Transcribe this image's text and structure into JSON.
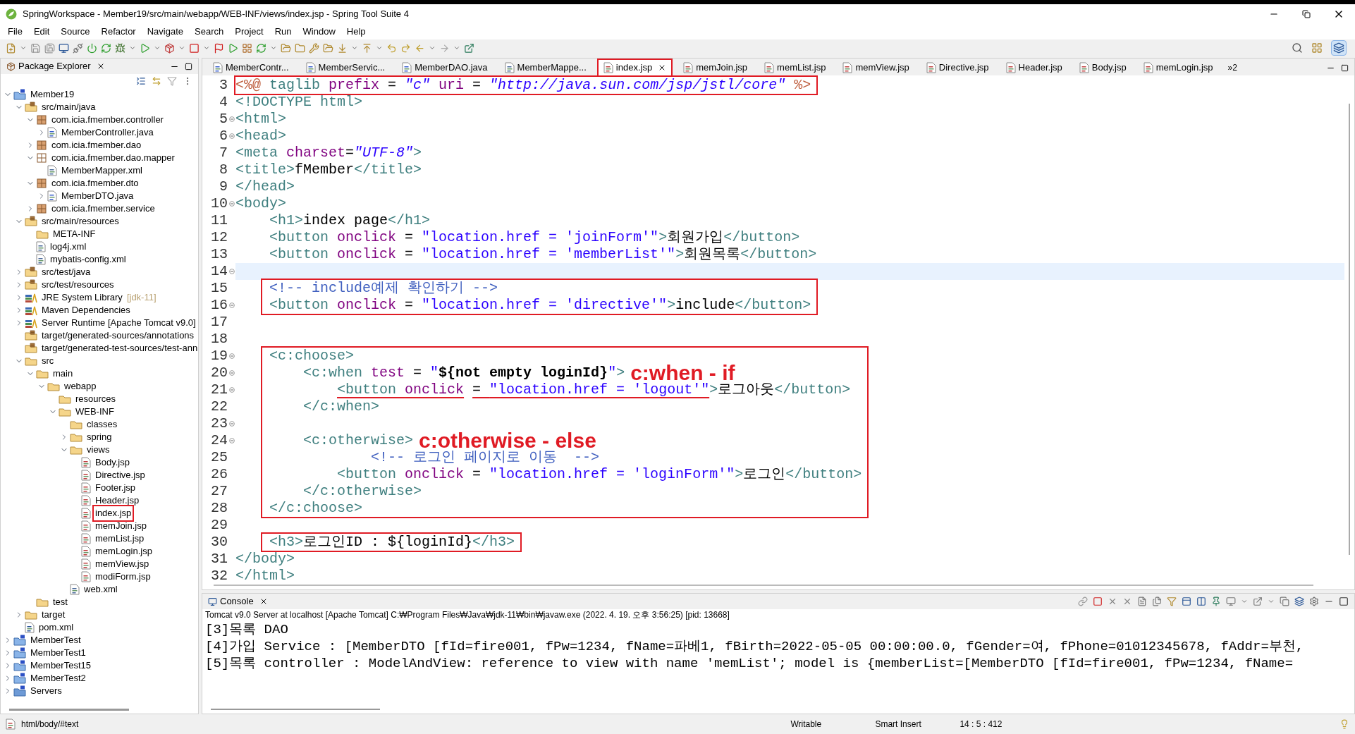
{
  "window": {
    "title": "SpringWorkspace - Member19/src/main/webapp/WEB-INF/views/index.jsp - Spring Tool Suite 4"
  },
  "menu": [
    "File",
    "Edit",
    "Source",
    "Refactor",
    "Navigate",
    "Search",
    "Project",
    "Run",
    "Window",
    "Help"
  ],
  "explorer": {
    "title": "Package Explorer",
    "tree": [
      {
        "label": "Member19",
        "kind": "project",
        "expanded": true,
        "children": [
          {
            "label": "src/main/java",
            "kind": "source-folder",
            "expanded": true,
            "children": [
              {
                "label": "com.icia.fmember.controller",
                "kind": "package",
                "expanded": true,
                "children": [
                  {
                    "label": "MemberController.java",
                    "kind": "java",
                    "expanded": false
                  }
                ]
              },
              {
                "label": "com.icia.fmember.dao",
                "kind": "package",
                "expanded": false
              },
              {
                "label": "com.icia.fmember.dao.mapper",
                "kind": "package-empty",
                "expanded": true,
                "children": [
                  {
                    "label": "MemberMapper.xml",
                    "kind": "xml"
                  }
                ]
              },
              {
                "label": "com.icia.fmember.dto",
                "kind": "package",
                "expanded": true,
                "children": [
                  {
                    "label": "MemberDTO.java",
                    "kind": "java",
                    "expanded": false
                  }
                ]
              },
              {
                "label": "com.icia.fmember.service",
                "kind": "package",
                "expanded": false
              }
            ]
          },
          {
            "label": "src/main/resources",
            "kind": "source-folder",
            "expanded": true,
            "children": [
              {
                "label": "META-INF",
                "kind": "folder"
              },
              {
                "label": "log4j.xml",
                "kind": "xml"
              },
              {
                "label": "mybatis-config.xml",
                "kind": "xml"
              }
            ]
          },
          {
            "label": "src/test/java",
            "kind": "source-folder",
            "expanded": false
          },
          {
            "label": "src/test/resources",
            "kind": "source-folder",
            "expanded": false
          },
          {
            "label": "JRE System Library",
            "note": "[jdk-11]",
            "kind": "library",
            "expanded": false
          },
          {
            "label": "Maven Dependencies",
            "kind": "library",
            "expanded": false
          },
          {
            "label": "Server Runtime [Apache Tomcat v9.0]",
            "kind": "library",
            "expanded": false
          },
          {
            "label": "target/generated-sources/annotations",
            "kind": "source-folder"
          },
          {
            "label": "target/generated-test-sources/test-ann",
            "kind": "source-folder"
          },
          {
            "label": "src",
            "kind": "folder",
            "expanded": true,
            "children": [
              {
                "label": "main",
                "kind": "folder",
                "expanded": true,
                "children": [
                  {
                    "label": "webapp",
                    "kind": "folder",
                    "expanded": true,
                    "children": [
                      {
                        "label": "resources",
                        "kind": "folder"
                      },
                      {
                        "label": "WEB-INF",
                        "kind": "folder",
                        "expanded": true,
                        "children": [
                          {
                            "label": "classes",
                            "kind": "folder"
                          },
                          {
                            "label": "spring",
                            "kind": "folder",
                            "expanded": false
                          },
                          {
                            "label": "views",
                            "kind": "folder",
                            "expanded": true,
                            "children": [
                              {
                                "label": "Body.jsp",
                                "kind": "jsp",
                                "highlighted": false
                              },
                              {
                                "label": "Directive.jsp",
                                "kind": "jsp",
                                "highlighted": false
                              },
                              {
                                "label": "Footer.jsp",
                                "kind": "jsp",
                                "highlighted": false
                              },
                              {
                                "label": "Header.jsp",
                                "kind": "jsp",
                                "highlighted": false
                              },
                              {
                                "label": "index.jsp",
                                "kind": "jsp",
                                "highlighted": true
                              },
                              {
                                "label": "memJoin.jsp",
                                "kind": "jsp",
                                "highlighted": false
                              },
                              {
                                "label": "memList.jsp",
                                "kind": "jsp",
                                "highlighted": false
                              },
                              {
                                "label": "memLogin.jsp",
                                "kind": "jsp",
                                "highlighted": false
                              },
                              {
                                "label": "memView.jsp",
                                "kind": "jsp",
                                "highlighted": false
                              },
                              {
                                "label": "modiForm.jsp",
                                "kind": "jsp",
                                "highlighted": false
                              }
                            ]
                          },
                          {
                            "label": "web.xml",
                            "kind": "xml"
                          }
                        ]
                      }
                    ]
                  }
                ]
              },
              {
                "label": "test",
                "kind": "folder"
              }
            ]
          },
          {
            "label": "target",
            "kind": "folder",
            "expanded": false
          },
          {
            "label": "pom.xml",
            "kind": "maven"
          }
        ]
      },
      {
        "label": "MemberTest",
        "kind": "project",
        "expanded": false
      },
      {
        "label": "MemberTest1",
        "kind": "project",
        "expanded": false
      },
      {
        "label": "MemberTest15",
        "kind": "project",
        "expanded": false
      },
      {
        "label": "MemberTest2",
        "kind": "project",
        "expanded": false
      },
      {
        "label": "Servers",
        "kind": "project-folder",
        "expanded": false
      }
    ]
  },
  "tabs": [
    {
      "label": "MemberContr...",
      "kind": "java",
      "selected": false
    },
    {
      "label": "MemberServic...",
      "kind": "java",
      "selected": false
    },
    {
      "label": "MemberDAO.java",
      "kind": "java",
      "selected": false
    },
    {
      "label": "MemberMappe...",
      "kind": "xml",
      "selected": false
    },
    {
      "label": "index.jsp",
      "kind": "jsp",
      "selected": true
    },
    {
      "label": "memJoin.jsp",
      "kind": "jsp",
      "selected": false
    },
    {
      "label": "memList.jsp",
      "kind": "jsp",
      "selected": false
    },
    {
      "label": "memView.jsp",
      "kind": "jsp",
      "selected": false
    },
    {
      "label": "Directive.jsp",
      "kind": "jsp",
      "selected": false
    },
    {
      "label": "Header.jsp",
      "kind": "jsp",
      "selected": false
    },
    {
      "label": "Body.jsp",
      "kind": "jsp",
      "selected": false
    },
    {
      "label": "memLogin.jsp",
      "kind": "jsp",
      "selected": false
    }
  ],
  "tabs_overflow": "»2",
  "editor": {
    "blocks": [
      {
        "outlined": true,
        "lines": [
          {
            "number": "3",
            "fold": false,
            "current": false,
            "tokens": [
              {
                "kind": "delim",
                "text": "<%@"
              },
              {
                "kind": "tag",
                "text": " taglib "
              },
              {
                "kind": "attr",
                "text": "prefix"
              },
              {
                "kind": "text",
                "text": " = "
              },
              {
                "kind": "string",
                "text": "\"c\""
              },
              {
                "kind": "attr",
                "text": " uri"
              },
              {
                "kind": "text",
                "text": " = "
              },
              {
                "kind": "string",
                "text": "\"http://java.sun.com/jsp/jstl/core\""
              },
              {
                "kind": "delim",
                "text": " %>"
              }
            ]
          }
        ]
      },
      {
        "outlined": false,
        "lines": [
          {
            "number": "4",
            "fold": false,
            "current": false,
            "tokens": [
              {
                "kind": "tag",
                "text": "<!DOCTYPE html>"
              }
            ]
          },
          {
            "number": "5",
            "fold": true,
            "current": false,
            "tokens": [
              {
                "kind": "tag",
                "text": "<html>"
              }
            ]
          },
          {
            "number": "6",
            "fold": true,
            "current": false,
            "tokens": [
              {
                "kind": "tag",
                "text": "<head>"
              }
            ]
          },
          {
            "number": "7",
            "fold": false,
            "current": false,
            "tokens": [
              {
                "kind": "tag",
                "text": "<meta "
              },
              {
                "kind": "attr",
                "text": "charset"
              },
              {
                "kind": "text",
                "text": "="
              },
              {
                "kind": "string",
                "text": "\"UTF-8\""
              },
              {
                "kind": "tag",
                "text": ">"
              }
            ]
          },
          {
            "number": "8",
            "fold": false,
            "current": false,
            "tokens": [
              {
                "kind": "tag",
                "text": "<title>"
              },
              {
                "kind": "text",
                "text": "fMember"
              },
              {
                "kind": "tag",
                "text": "</title>"
              }
            ]
          },
          {
            "number": "9",
            "fold": false,
            "current": false,
            "tokens": [
              {
                "kind": "tag",
                "text": "</head>"
              }
            ]
          },
          {
            "number": "10",
            "fold": true,
            "current": false,
            "tokens": [
              {
                "kind": "tag",
                "text": "<body>"
              }
            ]
          },
          {
            "number": "11",
            "fold": false,
            "current": false,
            "tokens": [
              {
                "kind": "tag",
                "text": "    <h1>"
              },
              {
                "kind": "text",
                "text": "index page"
              },
              {
                "kind": "tag",
                "text": "</h1>"
              }
            ]
          },
          {
            "number": "12",
            "fold": false,
            "current": false,
            "tokens": [
              {
                "kind": "tag",
                "text": "    <button "
              },
              {
                "kind": "attr",
                "text": "onclick"
              },
              {
                "kind": "text",
                "text": " = "
              },
              {
                "kind": "value",
                "text": "\"location.href = 'joinForm'\""
              },
              {
                "kind": "tag",
                "text": ">"
              },
              {
                "kind": "text",
                "text": "회원가입"
              },
              {
                "kind": "tag",
                "text": "</button>"
              }
            ]
          },
          {
            "number": "13",
            "fold": false,
            "current": false,
            "tokens": [
              {
                "kind": "tag",
                "text": "    <button "
              },
              {
                "kind": "attr",
                "text": "onclick"
              },
              {
                "kind": "text",
                "text": " = "
              },
              {
                "kind": "value",
                "text": "\"location.href = 'memberList'\""
              },
              {
                "kind": "tag",
                "text": ">"
              },
              {
                "kind": "text",
                "text": "회원목록"
              },
              {
                "kind": "tag",
                "text": "</button>"
              }
            ]
          },
          {
            "number": "14",
            "fold": true,
            "current": true
          }
        ]
      },
      {
        "outlined": true,
        "lines": [
          {
            "number": "15",
            "fold": false,
            "current": false,
            "tokens": [
              {
                "kind": "comment",
                "text": "    <!-- include예제 확인하기 -->"
              }
            ]
          },
          {
            "number": "16",
            "fold": true,
            "current": false,
            "tokens": [
              {
                "kind": "tag",
                "text": "    <button "
              },
              {
                "kind": "attr",
                "text": "onclick"
              },
              {
                "kind": "text",
                "text": " = "
              },
              {
                "kind": "value",
                "text": "\"location.href = 'directive'\""
              },
              {
                "kind": "tag",
                "text": ">"
              },
              {
                "kind": "text",
                "text": "include"
              },
              {
                "kind": "tag",
                "text": "</button>"
              }
            ]
          }
        ]
      },
      {
        "outlined": false,
        "lines": [
          {
            "number": "17",
            "fold": false,
            "current": false
          },
          {
            "number": "18",
            "fold": false,
            "current": false
          }
        ]
      },
      {
        "outlined": true,
        "lines": [
          {
            "number": "19",
            "fold": true,
            "current": false,
            "tokens": [
              {
                "kind": "tag",
                "text": "    <c:choose>"
              }
            ]
          },
          {
            "number": "20",
            "fold": true,
            "current": false,
            "tokens": [
              {
                "kind": "tag",
                "text": "        <c:when "
              },
              {
                "kind": "attr",
                "text": "test"
              },
              {
                "kind": "text",
                "text": " = "
              },
              {
                "kind": "value",
                "text": "\""
              },
              {
                "kind": "el",
                "text": "${not empty loginId}"
              },
              {
                "kind": "value",
                "text": "\""
              },
              {
                "kind": "tag",
                "text": ">"
              },
              {
                "kind": "callout",
                "text": "c:when - if"
              }
            ]
          },
          {
            "number": "21",
            "fold": true,
            "current": false,
            "tokens": [
              {
                "kind": "tag",
                "text": "            <button ",
                "underlined": true
              },
              {
                "kind": "attr",
                "text": "onclick",
                "underlined": true
              },
              {
                "kind": "text",
                "text": " = ",
                "underlined": true
              },
              {
                "kind": "value",
                "text": "\"location.href = 'logout'\"",
                "underlined": true
              },
              {
                "kind": "tag",
                "text": ">"
              },
              {
                "kind": "text",
                "text": "로그아웃"
              },
              {
                "kind": "tag",
                "text": "</button>"
              }
            ]
          },
          {
            "number": "22",
            "fold": false,
            "current": false,
            "tokens": [
              {
                "kind": "tag",
                "text": "        </c:when>"
              }
            ]
          },
          {
            "number": "23",
            "fold": true,
            "current": false
          },
          {
            "number": "24",
            "fold": true,
            "current": false,
            "tokens": [
              {
                "kind": "tag",
                "text": "        <c:otherwise>"
              },
              {
                "kind": "callout",
                "text": "c:otherwise - else"
              }
            ]
          },
          {
            "number": "25",
            "fold": false,
            "current": false,
            "tokens": [
              {
                "kind": "comment",
                "text": "                <!-- 로그인 페이지로 이동  -->"
              }
            ]
          },
          {
            "number": "26",
            "fold": false,
            "current": false,
            "tokens": [
              {
                "kind": "tag",
                "text": "            <button "
              },
              {
                "kind": "attr",
                "text": "onclick"
              },
              {
                "kind": "text",
                "text": " = "
              },
              {
                "kind": "value",
                "text": "\"location.href = 'loginForm'\""
              },
              {
                "kind": "tag",
                "text": ">"
              },
              {
                "kind": "text",
                "text": "로그인"
              },
              {
                "kind": "tag",
                "text": "</button>"
              }
            ]
          },
          {
            "number": "27",
            "fold": false,
            "current": false,
            "tokens": [
              {
                "kind": "tag",
                "text": "        </c:otherwise>"
              }
            ]
          },
          {
            "number": "28",
            "fold": false,
            "current": false,
            "tokens": [
              {
                "kind": "tag",
                "text": "    </c:choose>"
              }
            ]
          }
        ]
      },
      {
        "outlined": false,
        "lines": [
          {
            "number": "29",
            "fold": false,
            "current": false
          }
        ]
      },
      {
        "outlined": true,
        "lines": [
          {
            "number": "30",
            "fold": false,
            "current": false,
            "tokens": [
              {
                "kind": "tag",
                "text": "    <h3>"
              },
              {
                "kind": "text",
                "text": "로그인ID : ${loginId}"
              },
              {
                "kind": "tag",
                "text": "</h3>"
              }
            ]
          }
        ]
      },
      {
        "outlined": false,
        "lines": [
          {
            "number": "31",
            "fold": false,
            "current": false,
            "tokens": [
              {
                "kind": "tag",
                "text": "</body>"
              }
            ]
          },
          {
            "number": "32",
            "fold": false,
            "current": false,
            "tokens": [
              {
                "kind": "tag",
                "text": "</html>"
              }
            ]
          }
        ]
      }
    ]
  },
  "console": {
    "title": "Console",
    "description": "Tomcat v9.0 Server at localhost [Apache Tomcat] C:₩Program Files₩Java₩jdk-11₩bin₩javaw.exe  (2022. 4. 19. 오후 3:56:25) [pid: 13668]",
    "lines": [
      "[3]목록 DAO",
      "[4]가입 Service : [MemberDTO [fId=fire001, fPw=1234, fName=파베1, fBirth=2022-05-05 00:00:00.0, fGender=여, fPhone=01012345678, fAddr=부천,",
      "[5]목록 controller : ModelAndView: reference to view with name 'memList'; model is {memberList=[MemberDTO [fId=fire001, fPw=1234, fName="
    ]
  },
  "status_bar": {
    "path": "html/body/#text",
    "mode": "Writable",
    "insert": "Smart Insert",
    "position": "14 : 5 : 412"
  }
}
